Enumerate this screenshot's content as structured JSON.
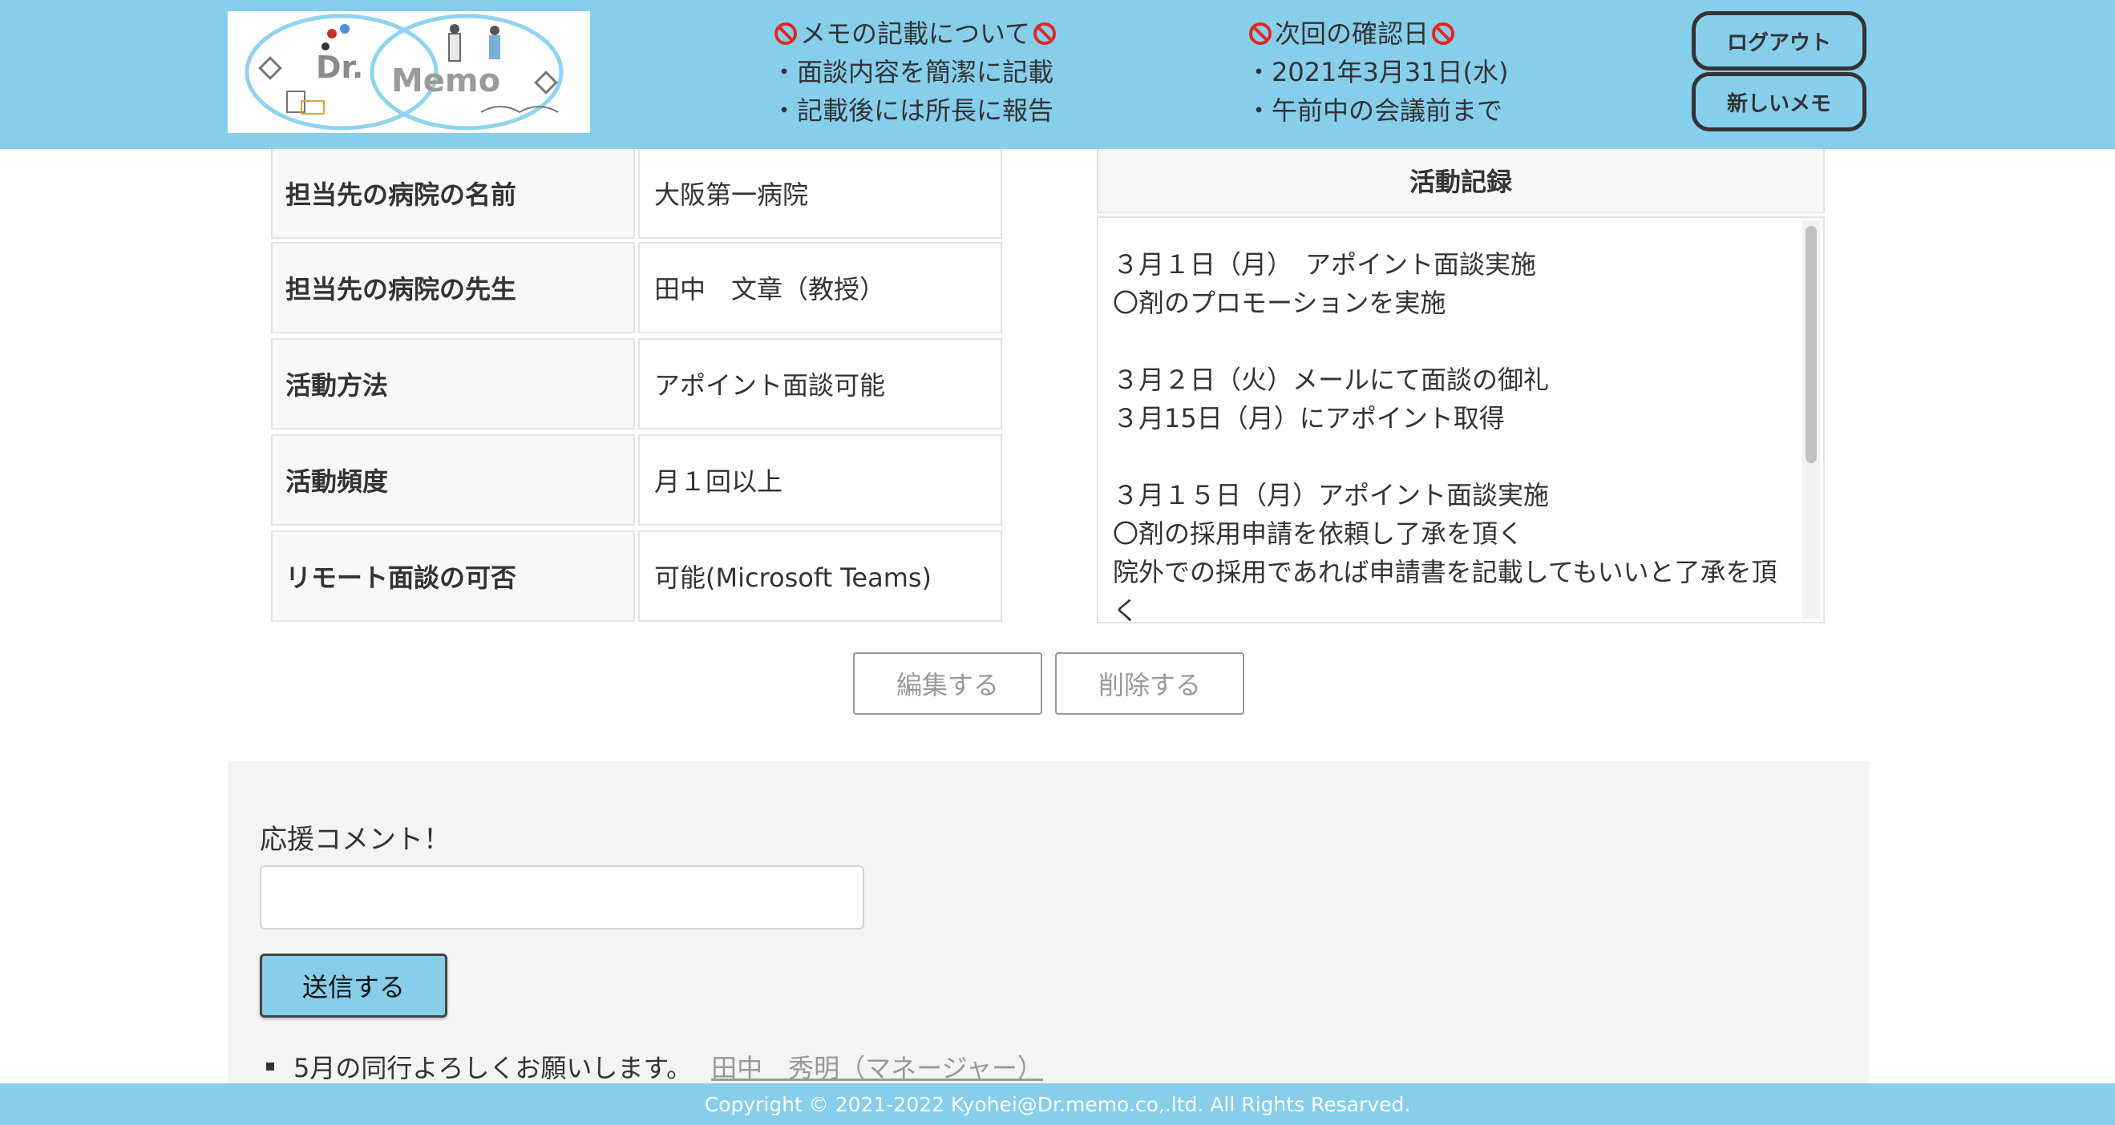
{
  "header": {
    "logo": {
      "text_dr": "Dr.",
      "text_memo": "Memo"
    },
    "notice_memo": {
      "title": "メモの記載について",
      "lines": [
        "・面談内容を簡潔に記載",
        "・記載後には所長に報告"
      ]
    },
    "notice_date": {
      "title": "次回の確認日",
      "lines": [
        "・2021年3月31日(水)",
        "・午前中の会議前まで"
      ]
    },
    "logout_label": "ログアウト",
    "new_memo_label": "新しいメモ",
    "accent_color": "#87ceeb",
    "icon_color": "#e0281f"
  },
  "info": {
    "rows": [
      {
        "label": "担当先の病院の名前",
        "value": "大阪第一病院"
      },
      {
        "label": "担当先の病院の先生",
        "value": "田中　文章（教授）"
      },
      {
        "label": "活動方法",
        "value": "アポイント面談可能"
      },
      {
        "label": "活動頻度",
        "value": "月１回以上"
      },
      {
        "label": "リモート面談の可否",
        "value": "可能(Microsoft Teams)"
      }
    ]
  },
  "activity": {
    "title": "活動記録",
    "text": "３月１日（月）　アポイント面談実施\n〇剤のプロモーションを実施\n\n３月２日（火）メールにて面談の御礼\n３月15日（月）にアポイント取得\n\n３月１５日（月）アポイント面談実施\n〇剤の採用申請を依頼し了承を頂く\n院外での採用であれば申請書を記載してもいいと了承を頂く"
  },
  "actions": {
    "edit_label": "編集する",
    "delete_label": "削除する"
  },
  "comments": {
    "label": "応援コメント！",
    "input_value": "",
    "submit_label": "送信する",
    "items": [
      {
        "text": "5月の同行よろしくお願いします。",
        "author": "田中　秀明（マネージャー）"
      }
    ]
  },
  "footer": {
    "copyright": "Copyright © 2021-2022 Kyohei@Dr.memo.co,.ltd. All Rights Resarved."
  }
}
